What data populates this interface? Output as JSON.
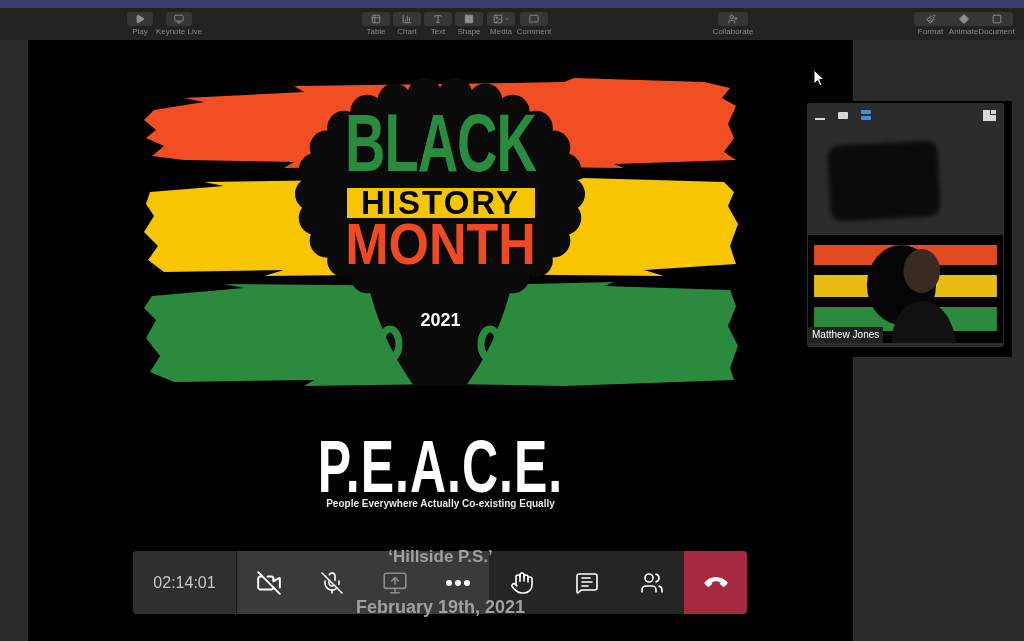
{
  "top_bar": {
    "left": [
      {
        "kind": "play",
        "label": "Play"
      },
      {
        "kind": "live",
        "label": "Keynote Live"
      }
    ],
    "insert": [
      {
        "kind": "table",
        "label": "Table"
      },
      {
        "kind": "chart",
        "label": "Chart"
      },
      {
        "kind": "text",
        "label": "Text"
      },
      {
        "kind": "shape",
        "label": "Shape"
      },
      {
        "kind": "media",
        "label": "Media"
      },
      {
        "kind": "comment",
        "label": "Comment"
      }
    ],
    "share": [
      {
        "kind": "collaborate",
        "label": "Collaborate"
      }
    ],
    "inspector": [
      {
        "kind": "format",
        "label": "Format"
      },
      {
        "kind": "animate",
        "label": "Animate"
      },
      {
        "kind": "document",
        "label": "Document"
      }
    ]
  },
  "slide": {
    "poster": {
      "line_1": "BLACK",
      "line_2": "HISTORY",
      "line_3": "MONTH",
      "year": "2021"
    },
    "acronym": "P.E.A.C.E.",
    "acronym_meaning": "People Everywhere Actually Co-existing Equally",
    "school": "‘Hillside P.S.’",
    "date": "February 19th, 2021"
  },
  "video_panel": {
    "view_buttons": [
      {
        "kind": "minimize",
        "selected": false
      },
      {
        "kind": "single",
        "selected": false
      },
      {
        "kind": "stacked",
        "selected": true
      }
    ],
    "speaker_name": "Matthew Jones"
  },
  "call_controls": {
    "timer": "02:14:01",
    "media_buttons": [
      {
        "kind": "camera",
        "on": false,
        "disabled": false
      },
      {
        "kind": "mic",
        "on": false,
        "disabled": false
      },
      {
        "kind": "share",
        "disabled": true
      },
      {
        "kind": "more",
        "disabled": false
      }
    ],
    "meeting_buttons": [
      {
        "kind": "hand"
      },
      {
        "kind": "chat"
      },
      {
        "kind": "people"
      }
    ],
    "hangup": {
      "kind": "hangup"
    }
  }
}
